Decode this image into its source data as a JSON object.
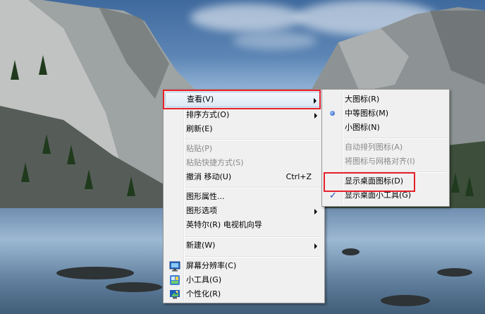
{
  "context_menu": {
    "items": [
      {
        "label": "查看(V)",
        "submenu": true
      },
      {
        "label": "排序方式(O)",
        "submenu": true
      },
      {
        "label": "刷新(E)"
      },
      {
        "label": "粘贴(P)",
        "disabled": true
      },
      {
        "label": "粘贴快捷方式(S)",
        "disabled": true
      },
      {
        "label": "撤消 移动(U)",
        "shortcut": "Ctrl+Z"
      },
      {
        "label": "图形属性..."
      },
      {
        "label": "图形选项",
        "submenu": true
      },
      {
        "label": "英特尔(R) 电视机向导"
      },
      {
        "label": "新建(W)",
        "submenu": true
      },
      {
        "label": "屏幕分辨率(C)",
        "icon": "display-icon"
      },
      {
        "label": "小工具(G)",
        "icon": "gadgets-icon"
      },
      {
        "label": "个性化(R)",
        "icon": "personalize-icon"
      }
    ]
  },
  "view_submenu": {
    "items": [
      {
        "label": "大图标(R)"
      },
      {
        "label": "中等图标(M)",
        "selected": true
      },
      {
        "label": "小图标(N)"
      },
      {
        "label": "自动排列图标(A)",
        "disabled": true
      },
      {
        "label": "将图标与网格对齐(I)",
        "disabled": true
      },
      {
        "label": "显示桌面图标(D)"
      },
      {
        "label": "显示桌面小工具(G)",
        "checked": true
      }
    ]
  },
  "check_mark": "✓",
  "highlight_color": "#e5202a"
}
